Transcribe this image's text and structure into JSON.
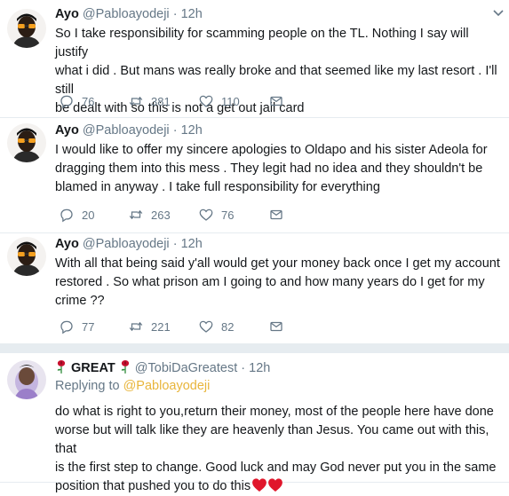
{
  "tweets": [
    {
      "name": "Ayo",
      "handle": "@Pabloayodeji",
      "sep": "·",
      "time": "12h",
      "lines": [
        "So I take responsibility for scamming people on the TL. Nothing I say will justify",
        "what i did . But mans was really broke and that seemed like my last resort . I'll still",
        "be dealt with so this is not a get out jail card"
      ],
      "replies": "76",
      "retweets": "381",
      "likes": "110"
    },
    {
      "name": "Ayo",
      "handle": "@Pabloayodeji",
      "sep": "·",
      "time": "12h",
      "lines": [
        "I would like to offer my sincere apologies to Oldapo and his sister Adeola for",
        "dragging them into this mess . They legit had no idea and they shouldn't be",
        "blamed in anyway . I take full responsibility for everything"
      ],
      "replies": "20",
      "retweets": "263",
      "likes": "76"
    },
    {
      "name": "Ayo",
      "handle": "@Pabloayodeji",
      "sep": "·",
      "time": "12h",
      "lines": [
        "With all that being said y'all would get your money back once I get my account",
        "restored . So what prison am I going to and how many years do I get for my",
        "crime ??"
      ],
      "replies": "77",
      "retweets": "221",
      "likes": "82"
    }
  ],
  "reply_tweet": {
    "name": "GREAT",
    "handle": "@TobiDaGreatest",
    "sep": "·",
    "time": "12h",
    "replying_label": "Replying to",
    "replying_handle": "@Pabloayodeji",
    "lines": [
      "do what is right to you,return their money, most of the people here have done",
      "worse but will talk like they are heavenly than Jesus. You came out with this, that",
      "is the first step to change. Good luck and may God never put you in the same",
      "position that pushed you to do this"
    ]
  },
  "icons": {
    "reply": "reply-icon",
    "retweet": "retweet-icon",
    "like": "heart-icon",
    "dm": "envelope-icon",
    "more": "chevron-down-icon",
    "rose": "rose-icon",
    "hearts": "red-heart-icon"
  },
  "colors": {
    "text": "#14171a",
    "muted": "#657786",
    "border": "#e6ecf0",
    "mention": "#e8b53b",
    "heart_red": "#e0162b"
  }
}
